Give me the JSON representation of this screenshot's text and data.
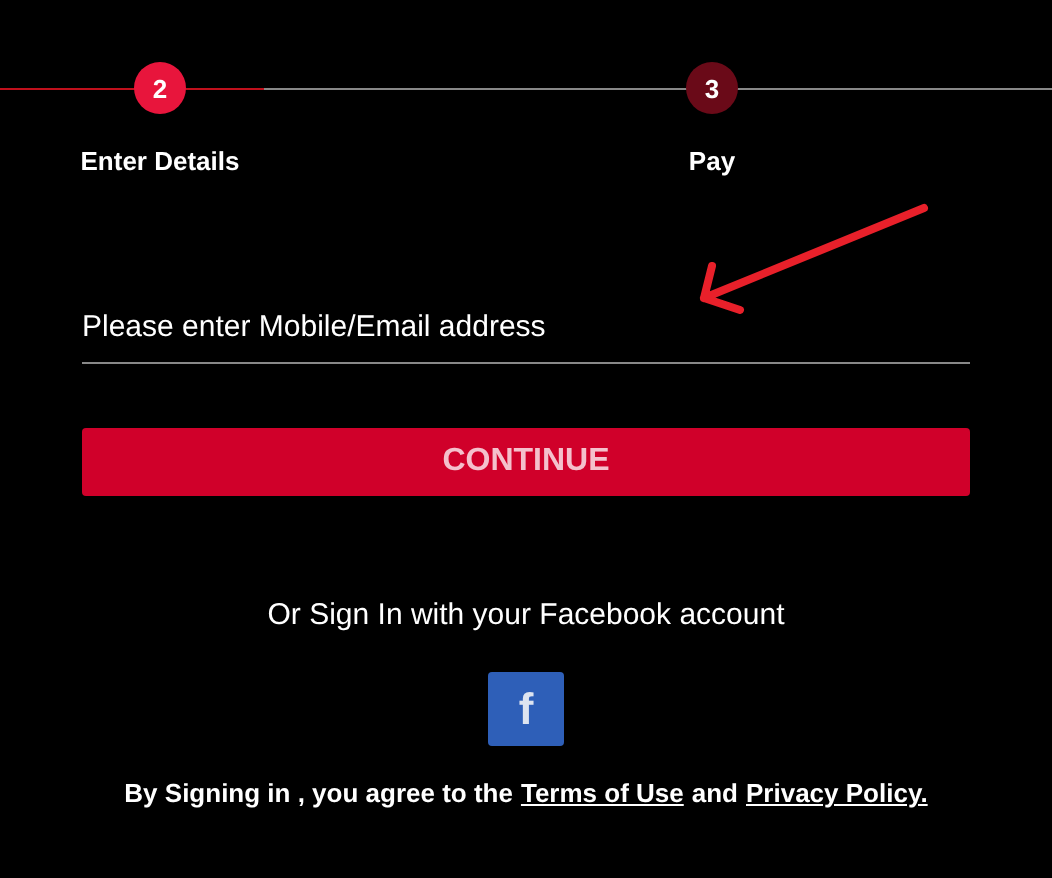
{
  "steps": [
    {
      "number": "2",
      "label": "Enter Details",
      "selected": true
    },
    {
      "number": "3",
      "label": "Pay",
      "selected": false
    }
  ],
  "login_field": {
    "placeholder": "Please enter Mobile/Email address"
  },
  "continue_button": {
    "label": "CONTINUE"
  },
  "facebook_prompt": "Or Sign In with your Facebook account",
  "facebook_button": {
    "label": "f"
  },
  "agreement": "**By Signing in , you agree to the**",
  "terms_link": "Terms of Use",
  "agreement_and": "and",
  "privacy_link": "Privacy Policy."
}
